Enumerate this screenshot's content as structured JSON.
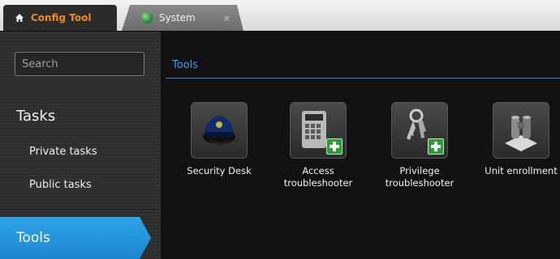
{
  "tabs": [
    {
      "label": "Config Tool",
      "icon": "home-icon",
      "active": true
    },
    {
      "label": "System",
      "icon": "globe-icon",
      "active": false,
      "close_label": "×"
    }
  ],
  "sidebar": {
    "search_placeholder": "Search",
    "tasks_heading": "Tasks",
    "items": [
      {
        "label": "Private tasks"
      },
      {
        "label": "Public tasks"
      }
    ],
    "selected": {
      "label": "Tools"
    }
  },
  "main": {
    "section_title": "Tools",
    "tools": [
      {
        "label": "Security Desk",
        "icon": "police-cap-icon"
      },
      {
        "label": "Access\ntroubleshooter",
        "icon": "keypad-add-icon"
      },
      {
        "label": "Privilege\ntroubleshooter",
        "icon": "keys-add-icon"
      },
      {
        "label": "Unit enrollment",
        "icon": "binoculars-icon"
      }
    ]
  },
  "colors": {
    "accent": "#1c86cf",
    "active_tab_text": "#f08a1c",
    "section_title": "#3c9ee4"
  }
}
